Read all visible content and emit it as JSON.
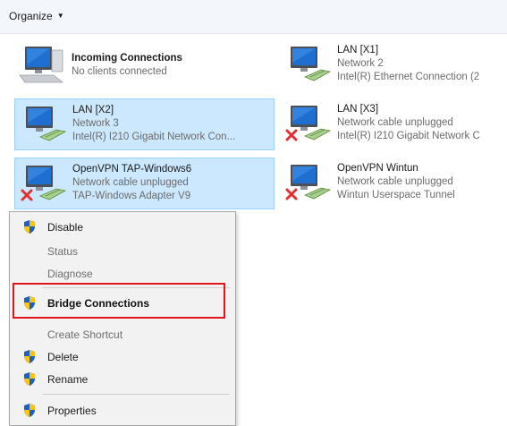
{
  "toolbar": {
    "organize_label": "Organize"
  },
  "connections": [
    {
      "name": "Incoming Connections",
      "line1": "No clients connected",
      "line2": ""
    },
    {
      "name": "LAN [X1]",
      "line1": "Network  2",
      "line2": "Intel(R) Ethernet Connection (2"
    },
    {
      "name": "LAN [X2]",
      "line1": "Network  3",
      "line2": "Intel(R) I210 Gigabit Network Con..."
    },
    {
      "name": "LAN [X3]",
      "line1": "Network cable unplugged",
      "line2": "Intel(R) I210 Gigabit Network C"
    },
    {
      "name": "OpenVPN TAP-Windows6",
      "line1": "Network cable unplugged",
      "line2": "TAP-Windows Adapter V9"
    },
    {
      "name": "OpenVPN Wintun",
      "line1": "Network cable unplugged",
      "line2": "Wintun Userspace Tunnel"
    }
  ],
  "context_menu": {
    "items": [
      {
        "label": "Disable"
      },
      {
        "label": "Status"
      },
      {
        "label": "Diagnose"
      },
      {
        "label": "Bridge Connections"
      },
      {
        "label": "Create Shortcut"
      },
      {
        "label": "Delete"
      },
      {
        "label": "Rename"
      },
      {
        "label": "Properties"
      }
    ]
  },
  "colors": {
    "selection": "#cce8ff",
    "highlight_border": "#e0161c",
    "shield_blue": "#1e5fbf",
    "shield_yellow": "#f5c518",
    "error_red": "#e03030"
  },
  "icons": [
    "monitor-icon",
    "network-adapter-icon",
    "error-x-icon",
    "shield-icon",
    "chevron-down-icon"
  ]
}
